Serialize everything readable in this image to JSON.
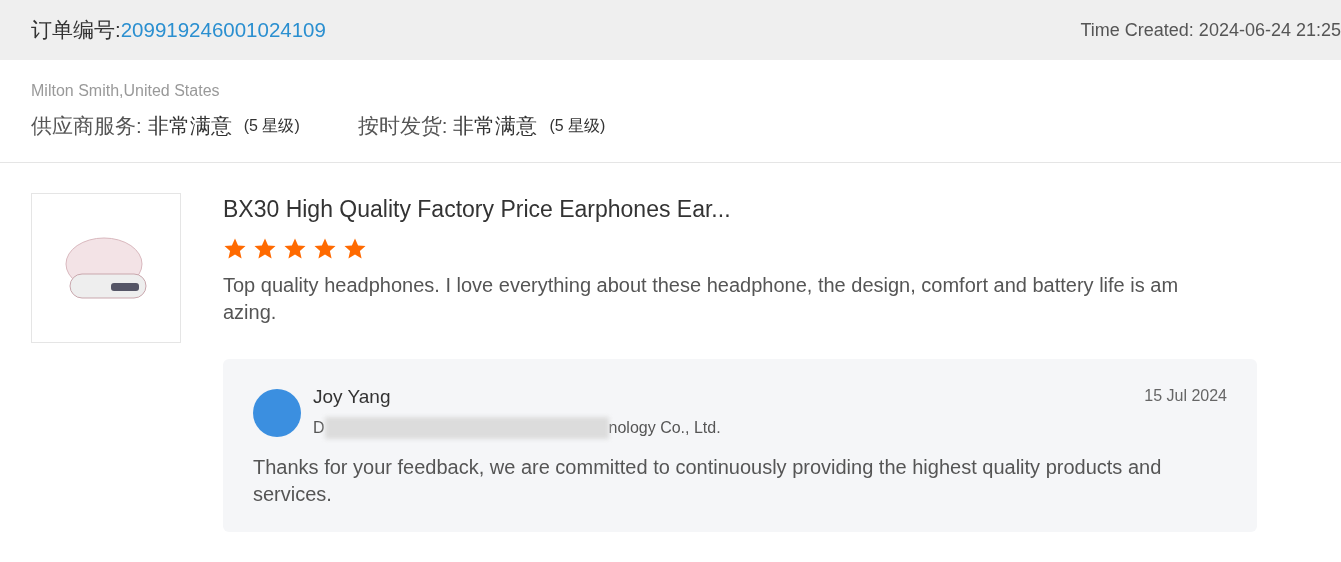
{
  "order": {
    "label": "订单编号:",
    "number": "209919246001024109",
    "time_created": "Time Created: 2024-06-24 21:25"
  },
  "buyer": "Milton Smith,United States",
  "ratings": [
    {
      "label": "供应商服务:",
      "value": "非常满意",
      "stars_text": "(5 星级)"
    },
    {
      "label": "按时发货:",
      "value": "非常满意",
      "stars_text": "(5 星级)"
    }
  ],
  "product": {
    "title": "BX30 High Quality Factory Price Earphones Ear...",
    "stars": 5,
    "review": "Top quality headphones. I love everything about these headphone, the design, comfort and battery life is amazing."
  },
  "reply": {
    "name": "Joy Yang",
    "company_start": "D",
    "company_end": "nology Co., Ltd.",
    "date": "15 Jul 2024",
    "text": "Thanks for your feedback, we are committed to continuously providing the highest quality products and services."
  }
}
